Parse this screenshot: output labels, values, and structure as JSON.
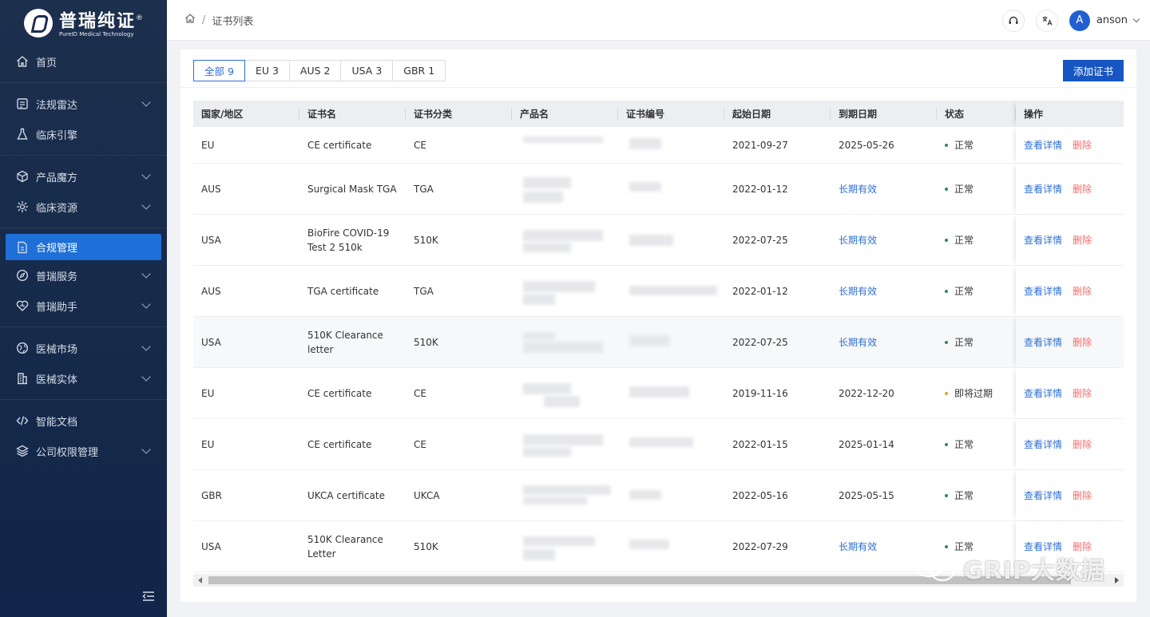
{
  "brand": {
    "name_cn": "普瑞纯证",
    "reg": "®",
    "name_en": "PureID Medical Technology"
  },
  "sidebar": {
    "items": [
      {
        "label": "首页",
        "icon": "home-icon",
        "has_children": false
      },
      {
        "label": "法规雷达",
        "icon": "radar-icon",
        "has_children": true
      },
      {
        "label": "临床引擎",
        "icon": "flask-icon",
        "has_children": false
      },
      {
        "label": "产品魔方",
        "icon": "cube-icon",
        "has_children": true
      },
      {
        "label": "临床资源",
        "icon": "resource-icon",
        "has_children": true
      },
      {
        "label": "合规管理",
        "icon": "document-icon",
        "has_children": false,
        "active": true
      },
      {
        "label": "普瑞服务",
        "icon": "compass-icon",
        "has_children": true
      },
      {
        "label": "普瑞助手",
        "icon": "heart-icon",
        "has_children": true
      },
      {
        "label": "医械市场",
        "icon": "globe-icon",
        "has_children": true
      },
      {
        "label": "医械实体",
        "icon": "building-icon",
        "has_children": true
      },
      {
        "label": "智能文档",
        "icon": "code-icon",
        "has_children": false
      },
      {
        "label": "公司权限管理",
        "icon": "layers-icon",
        "has_children": true
      }
    ]
  },
  "header": {
    "breadcrumb": [
      "证书列表"
    ],
    "user": {
      "initial": "A",
      "name": "anson"
    }
  },
  "tabs": [
    {
      "label": "全部 9",
      "active": true
    },
    {
      "label": "EU 3",
      "active": false
    },
    {
      "label": "AUS 2",
      "active": false
    },
    {
      "label": "USA 3",
      "active": false
    },
    {
      "label": "GBR 1",
      "active": false
    }
  ],
  "add_button": "添加证书",
  "table": {
    "columns": [
      "国家/地区",
      "证书名",
      "证书分类",
      "产品名",
      "证书编号",
      "起始日期",
      "到期日期",
      "状态",
      "操作"
    ],
    "view_label": "查看详情",
    "delete_label": "删除",
    "rows": [
      {
        "country": "EU",
        "name": "CE certificate",
        "category": "CE",
        "start": "2021-09-27",
        "end": "2025-05-26",
        "end_link": false,
        "status": "正常",
        "status_color": "#2e8b57"
      },
      {
        "country": "AUS",
        "name": "Surgical Mask TGA",
        "category": "TGA",
        "start": "2022-01-12",
        "end": "长期有效",
        "end_link": true,
        "status": "正常",
        "status_color": "#2e8b57"
      },
      {
        "country": "USA",
        "name": "BioFire COVID-19 Test 2 510k",
        "category": "510K",
        "start": "2022-07-25",
        "end": "长期有效",
        "end_link": true,
        "status": "正常",
        "status_color": "#2e8b57"
      },
      {
        "country": "AUS",
        "name": "TGA certificate",
        "category": "TGA",
        "start": "2022-01-12",
        "end": "长期有效",
        "end_link": true,
        "status": "正常",
        "status_color": "#2e8b57"
      },
      {
        "country": "USA",
        "name": "510K Clearance letter",
        "category": "510K",
        "start": "2022-07-25",
        "end": "长期有效",
        "end_link": true,
        "status": "正常",
        "status_color": "#2e8b57"
      },
      {
        "country": "EU",
        "name": "CE certificate",
        "category": "CE",
        "start": "2019-11-16",
        "end": "2022-12-20",
        "end_link": false,
        "status": "即将过期",
        "status_color": "#e6a23c"
      },
      {
        "country": "EU",
        "name": "CE certificate",
        "category": "CE",
        "start": "2022-01-15",
        "end": "2025-01-14",
        "end_link": false,
        "status": "正常",
        "status_color": "#2e8b57"
      },
      {
        "country": "GBR",
        "name": "UKCA certificate",
        "category": "UKCA",
        "start": "2022-05-16",
        "end": "2025-05-15",
        "end_link": false,
        "status": "正常",
        "status_color": "#2e8b57"
      },
      {
        "country": "USA",
        "name": "510K Clearance Letter",
        "category": "510K",
        "start": "2022-07-29",
        "end": "长期有效",
        "end_link": true,
        "status": "正常",
        "status_color": "#2e8b57"
      }
    ]
  },
  "watermark": "GRIP大数据",
  "colors": {
    "primary": "#1756c2",
    "link": "#2d6fd6",
    "danger": "#f56c6c",
    "sidebar_bg": "#1c2f4d",
    "active_nav": "#1e6fd8"
  }
}
